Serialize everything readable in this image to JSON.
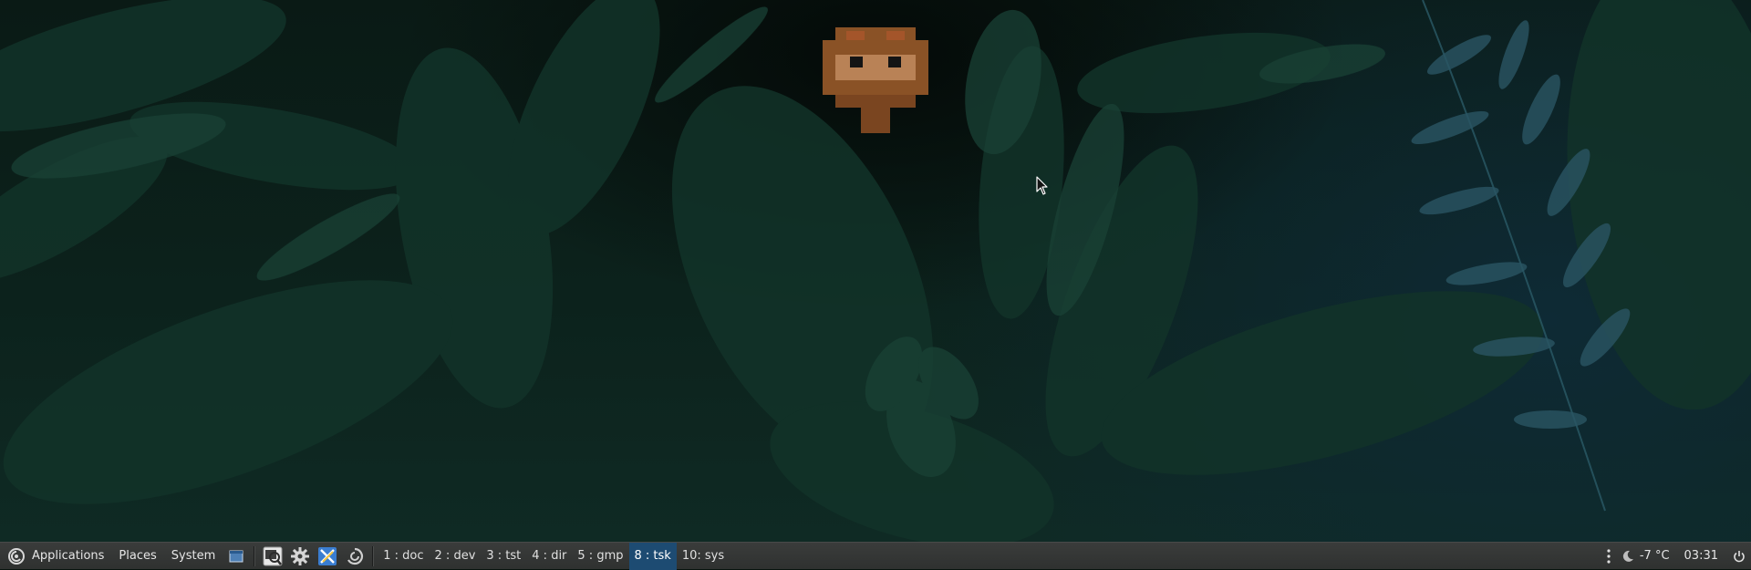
{
  "desktop": {
    "wallpaper": "dark jungle leaves illustration",
    "icon": "pixel-face-icon"
  },
  "taskbar": {
    "menus": [
      {
        "label": "Applications",
        "icon": "app-menu-icon"
      },
      {
        "label": "Places"
      },
      {
        "label": "System"
      }
    ],
    "launchers": [
      "show-desktop-icon",
      "screenshot-icon",
      "settings-gear-icon",
      "editor-icon",
      "debian-swirl-icon"
    ],
    "workspaces": [
      {
        "label": "1 : doc",
        "active": false
      },
      {
        "label": "2 : dev",
        "active": false
      },
      {
        "label": "3 : tst",
        "active": false
      },
      {
        "label": "4 : dir",
        "active": false
      },
      {
        "label": "5 : gmp",
        "active": false
      },
      {
        "label": "8 : tsk",
        "active": true
      },
      {
        "label": "10: sys",
        "active": false
      }
    ],
    "tray": {
      "weather_icon": "moon-icon",
      "temperature": "-7 °C",
      "clock": "03:31",
      "power_icon": "power-icon"
    }
  },
  "colors": {
    "taskbar_bg": "#353736",
    "active_workspace": "#1d4b72",
    "text": "#e6e6e6"
  }
}
